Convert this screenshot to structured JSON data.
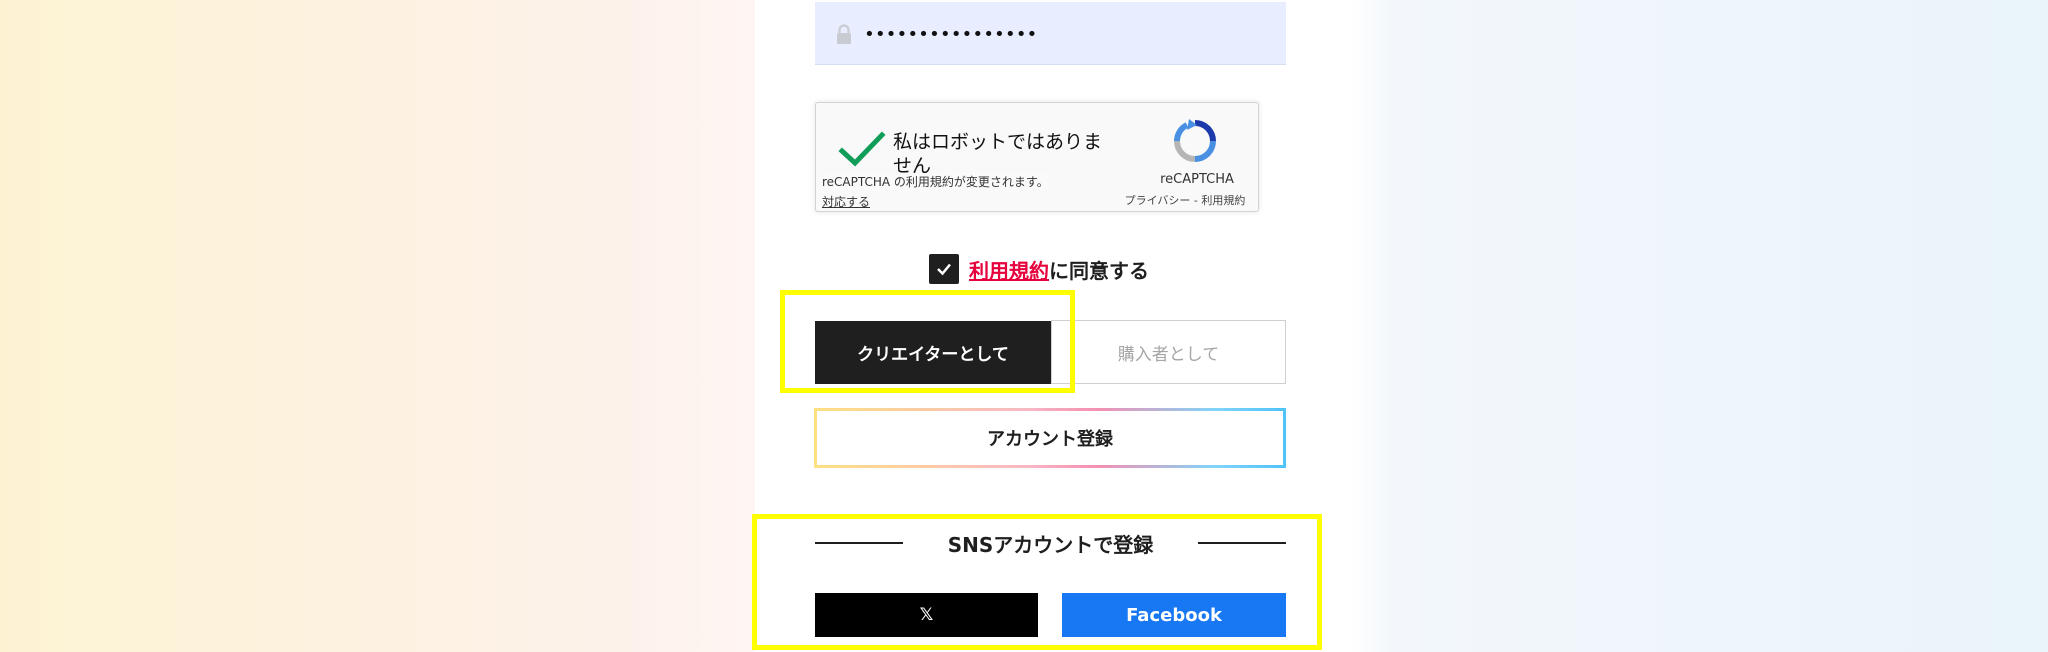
{
  "password_field": {
    "value": "••••••••••••••••",
    "icon": "lock-icon"
  },
  "recaptcha": {
    "label": "私はロボットではありません",
    "terms_notice": "reCAPTCHA の利用規約が変更されます。",
    "terms_action": "対応する",
    "brand": "reCAPTCHA",
    "privacy_terms": "プライバシー - 利用規約",
    "checked": true
  },
  "agreement": {
    "checked": true,
    "terms_link": "利用規約",
    "suffix": "に同意する"
  },
  "account_type": {
    "creator_label": "クリエイターとして",
    "buyer_label": "購入者として",
    "selected": "creator"
  },
  "register_button": {
    "label": "アカウント登録"
  },
  "sns": {
    "title": "SNSアカウントで登録",
    "x_label": "𝕏",
    "facebook_label": "Facebook"
  },
  "colors": {
    "accent_red": "#e6003c",
    "facebook_blue": "#1877f2",
    "highlight_yellow": "#ffff00",
    "dark": "#1f1f1f"
  }
}
